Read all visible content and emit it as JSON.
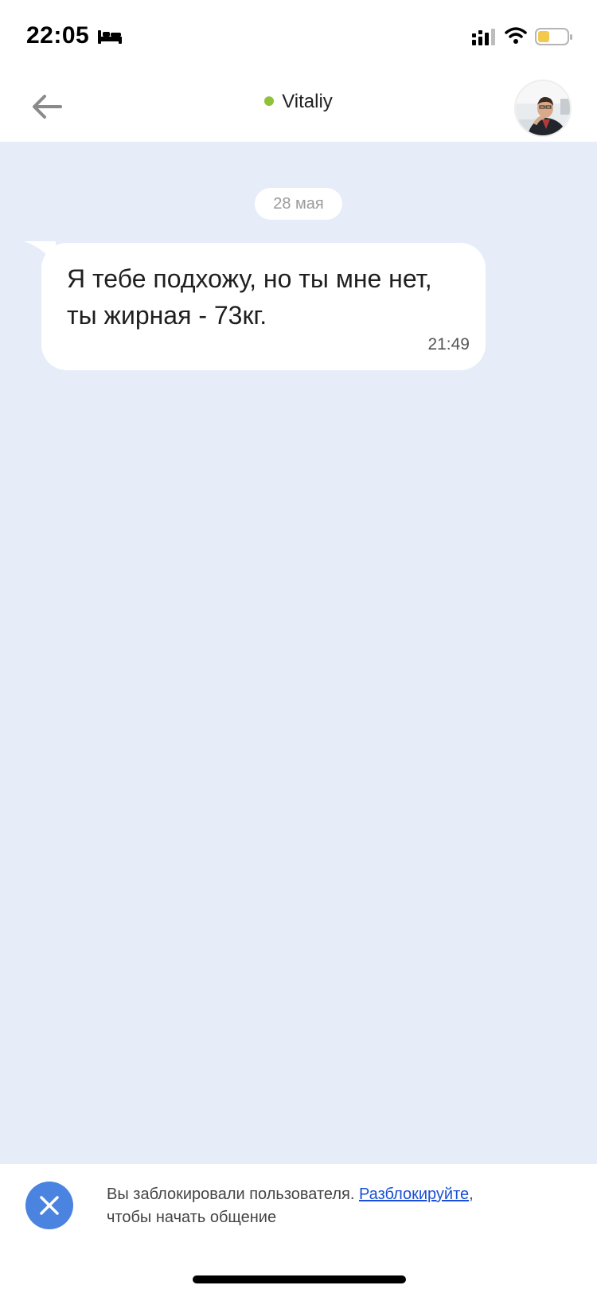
{
  "status_bar": {
    "time": "22:05",
    "icons": [
      "bed-icon",
      "signal-icon",
      "wifi-icon",
      "battery-icon"
    ],
    "battery_color": "#f2c94c"
  },
  "header": {
    "contact_name": "Vitaliy",
    "online_color": "#8fc23a",
    "back_icon": "arrow-left-icon"
  },
  "chat": {
    "background": "#e6ecf8",
    "date_label": "28 мая",
    "messages": [
      {
        "text": "Я тебе подхожу, но ты мне нет, ты жирная - 73кг.",
        "time": "21:49"
      }
    ]
  },
  "blocked_bar": {
    "text": "Вы заблокировали пользователя.",
    "link": "Разблокируйте",
    "comma": ",",
    "text_after": "чтобы начать общение",
    "button_color": "#4a84e0",
    "icon": "close-icon"
  }
}
